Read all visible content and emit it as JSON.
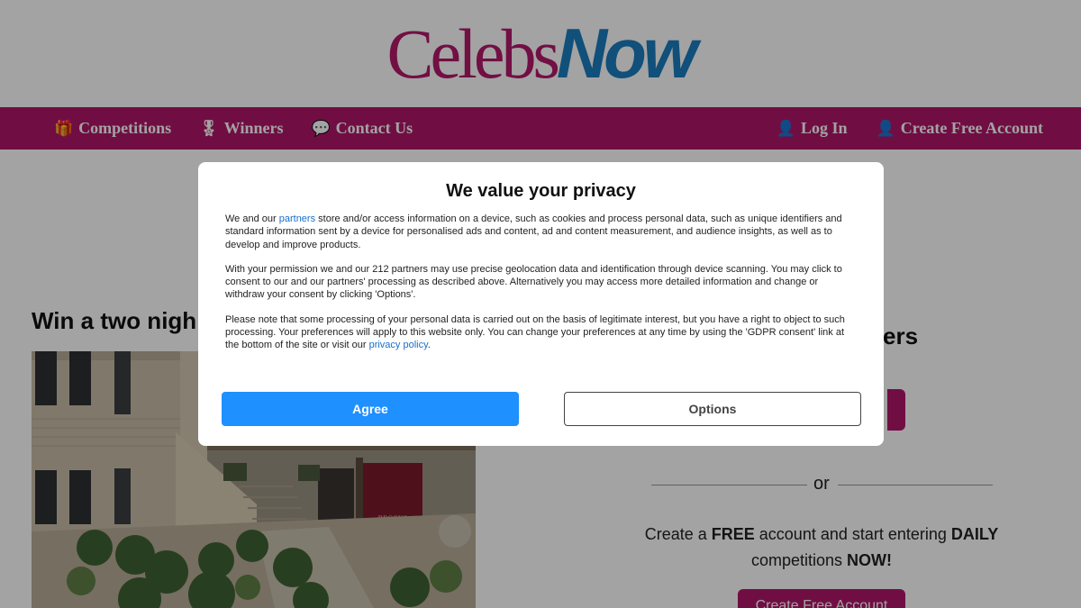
{
  "header": {
    "logo_part1": "Celebs",
    "logo_part2": "Now"
  },
  "nav": {
    "left": [
      {
        "label": "Competitions",
        "icon": "gift-icon",
        "glyph": "🎁"
      },
      {
        "label": "Winners",
        "icon": "award-icon",
        "glyph": "🎖"
      },
      {
        "label": "Contact Us",
        "icon": "chat-icon",
        "glyph": "💬"
      }
    ],
    "right": [
      {
        "label": "Log In",
        "icon": "user-icon",
        "glyph": "👤"
      },
      {
        "label": "Create Free Account",
        "icon": "user-plus-icon",
        "glyph": "👤"
      }
    ]
  },
  "page": {
    "prize_title": "Win a two nigh",
    "side_heading": "ers",
    "or": "or",
    "create_text_prefix": "Create a ",
    "create_text_free": "FREE",
    "create_text_mid": " account and start entering ",
    "create_text_daily": "DAILY",
    "create_text_line2_prefix": "competitions ",
    "create_text_now": "NOW!",
    "create_button": "Create Free Account",
    "sign_text": "BROOKS"
  },
  "modal": {
    "title": "We value your privacy",
    "p1_before_link": "We and our ",
    "p1_link": "partners",
    "p1_after_link": " store and/or access information on a device, such as cookies and process personal data, such as unique identifiers and standard information sent by a device for personalised ads and content, ad and content measurement, and audience insights, as well as to develop and improve products.",
    "p2": "With your permission we and our 212 partners may use precise geolocation data and identification through device scanning. You may click to consent to our and our partners' processing as described above. Alternatively you may access more detailed information and change or withdraw your consent by clicking 'Options'.",
    "p3_before_link": "Please note that some processing of your personal data is carried out on the basis of legitimate interest, but you have a right to object to such processing. Your preferences will apply to this website only. You can change your preferences at any time by using the 'GDPR consent' link at the bottom of the site or visit our ",
    "p3_link": "privacy policy",
    "p3_after_link": ".",
    "agree_label": "Agree",
    "options_label": "Options"
  },
  "colors": {
    "brand_magenta": "#b0176a",
    "brand_blue": "#1a7dbf",
    "agree_blue": "#1e90ff"
  }
}
